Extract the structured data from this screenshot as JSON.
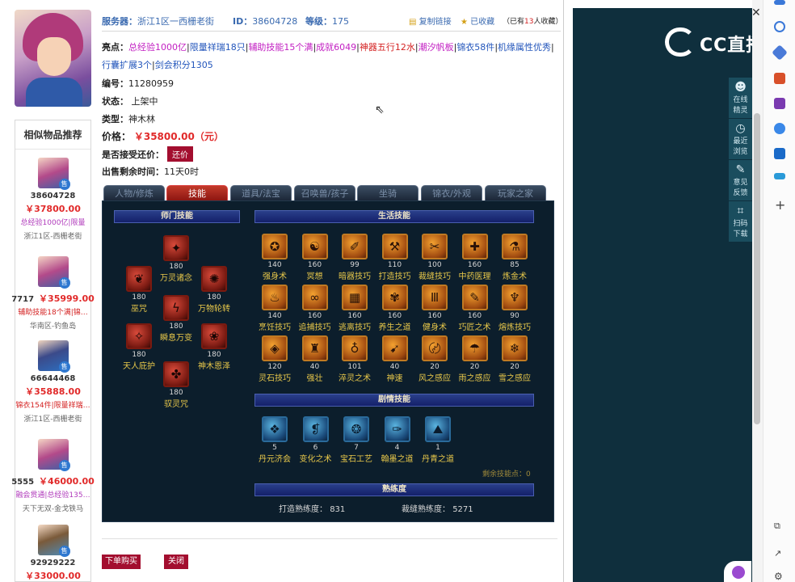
{
  "header": {
    "server_label": "服务器：",
    "server_value": "浙江1区一西栅老街",
    "id_label": "ID：",
    "id_value": "38604728",
    "level_label": "等级：",
    "level_value": "175",
    "copy_link": "复制链接",
    "favorited": "已收藏",
    "fav_count_prefix": "（已有",
    "fav_count": "13",
    "fav_count_suffix": "人收藏）"
  },
  "info": {
    "highlight_label": "亮点：",
    "highlights": [
      "总经验1000亿",
      "限量祥瑞18只",
      "辅助技能15个满",
      "成就6049",
      "神器五行12水",
      "潮汐帆板",
      "锦衣58件",
      "机缘属性优秀",
      "行囊扩展3个",
      "剑会积分1305"
    ],
    "number_label": "编号：",
    "number_value": "11280959",
    "status_label": "状态：",
    "status_value": "上架中",
    "type_label": "类型：",
    "type_value": "神木林",
    "price_label": "价格：",
    "price_value": "￥35800.00（元）",
    "bargain_label": "是否接受还价：",
    "bargain_button": "还价",
    "time_label": "出售剩余时间：",
    "time_value": "11天0时"
  },
  "tabs": [
    "人物/修炼",
    "技能",
    "道具/法宝",
    "召唤兽/孩子",
    "坐骑",
    "锦衣/外观",
    "玩家之家"
  ],
  "active_tab": "技能",
  "skills": {
    "school_title": "师门技能",
    "life_title": "生活技能",
    "story_title": "剧情技能",
    "prof_title": "熟练度",
    "school": [
      {
        "level": "180",
        "name": "万灵诸念",
        "glyph": "✦"
      },
      {
        "level": "180",
        "name": "巫咒",
        "glyph": "❦"
      },
      {
        "level": "180",
        "name": "万物轮转",
        "glyph": "✺"
      },
      {
        "level": "180",
        "name": "瞬息万变",
        "glyph": "ϟ"
      },
      {
        "level": "180",
        "name": "天人庇护",
        "glyph": "✧"
      },
      {
        "level": "180",
        "name": "神木恩泽",
        "glyph": "❀"
      },
      {
        "level": "180",
        "name": "驭灵咒",
        "glyph": "✤"
      }
    ],
    "life": [
      {
        "level": "140",
        "name": "强身术",
        "glyph": "✪"
      },
      {
        "level": "160",
        "name": "冥想",
        "glyph": "☯"
      },
      {
        "level": "99",
        "name": "暗器技巧",
        "glyph": "✐"
      },
      {
        "level": "110",
        "name": "打造技巧",
        "glyph": "⚒"
      },
      {
        "level": "100",
        "name": "裁缝技巧",
        "glyph": "✂"
      },
      {
        "level": "160",
        "name": "中药医理",
        "glyph": "✚"
      },
      {
        "level": "85",
        "name": "炼金术",
        "glyph": "⚗"
      },
      {
        "level": "140",
        "name": "烹饪技巧",
        "glyph": "♨"
      },
      {
        "level": "160",
        "name": "追捕技巧",
        "glyph": "∞"
      },
      {
        "level": "160",
        "name": "逃离技巧",
        "glyph": "▦"
      },
      {
        "level": "160",
        "name": "养生之道",
        "glyph": "✾"
      },
      {
        "level": "160",
        "name": "健身术",
        "glyph": "Ⅲ"
      },
      {
        "level": "160",
        "name": "巧匠之术",
        "glyph": "✎"
      },
      {
        "level": "90",
        "name": "熔炼技巧",
        "glyph": "♆"
      },
      {
        "level": "120",
        "name": "灵石技巧",
        "glyph": "◈"
      },
      {
        "level": "40",
        "name": "强壮",
        "glyph": "♜"
      },
      {
        "level": "101",
        "name": "淬灵之术",
        "glyph": "♁"
      },
      {
        "level": "40",
        "name": "神速",
        "glyph": "➹"
      },
      {
        "level": "20",
        "name": "风之感应",
        "glyph": "〄"
      },
      {
        "level": "20",
        "name": "雨之感应",
        "glyph": "☂"
      },
      {
        "level": "20",
        "name": "雪之感应",
        "glyph": "❄"
      }
    ],
    "story": [
      {
        "level": "5",
        "name": "丹元济会",
        "glyph": "❖"
      },
      {
        "level": "6",
        "name": "变化之术",
        "glyph": "❡"
      },
      {
        "level": "7",
        "name": "宝石工艺",
        "glyph": "❂"
      },
      {
        "level": "4",
        "name": "翰墨之道",
        "glyph": "✑"
      },
      {
        "level": "1",
        "name": "丹青之道",
        "glyph": "⛰"
      }
    ],
    "remain_label": "剩余技能点：",
    "remain_value": "0",
    "forge_label": "打造熟练度：",
    "forge_value": "831",
    "tailor_label": "裁缝熟练度：",
    "tailor_value": "5271"
  },
  "similar": {
    "title": "相似物品推荐",
    "items": [
      {
        "id": "38604728",
        "price": "￥37800.00",
        "tag": "总经验1000亿|限量",
        "server": "浙江1区-西栅老街"
      },
      {
        "id": "7717",
        "price": "￥35999.00",
        "tag": "辅助技能18个满|锦…",
        "server": "华南区-钓鱼岛"
      },
      {
        "id": "66644468",
        "price": "￥35888.00",
        "tag": "锦衣154件|限量祥瑞…",
        "server": "浙江1区-西栅老街"
      },
      {
        "id": "5555",
        "price": "￥46000.00",
        "tag": "融会贯通|总经验135…",
        "server": "天下无双-金戈铁马"
      },
      {
        "id": "92929222",
        "price": "￥33000.00",
        "tag": "",
        "server": ""
      }
    ],
    "sold_badge": "售"
  },
  "actions": {
    "buy": "下单购买",
    "close": "关闭"
  },
  "right_panel": {
    "logo_text": "CC直播",
    "tools": [
      {
        "icon": "☻",
        "label": "在线精灵"
      },
      {
        "icon": "◷",
        "label": "最近浏览"
      },
      {
        "icon": "✎",
        "label": "意见反馈"
      },
      {
        "icon": "⌗",
        "label": "扫码下载"
      }
    ]
  },
  "colors": {
    "brand_red": "#a30e2f",
    "link_blue": "#3a6ab0",
    "panel_dark": "#0f2f3d",
    "highlight_purple": "#c21fc2"
  }
}
